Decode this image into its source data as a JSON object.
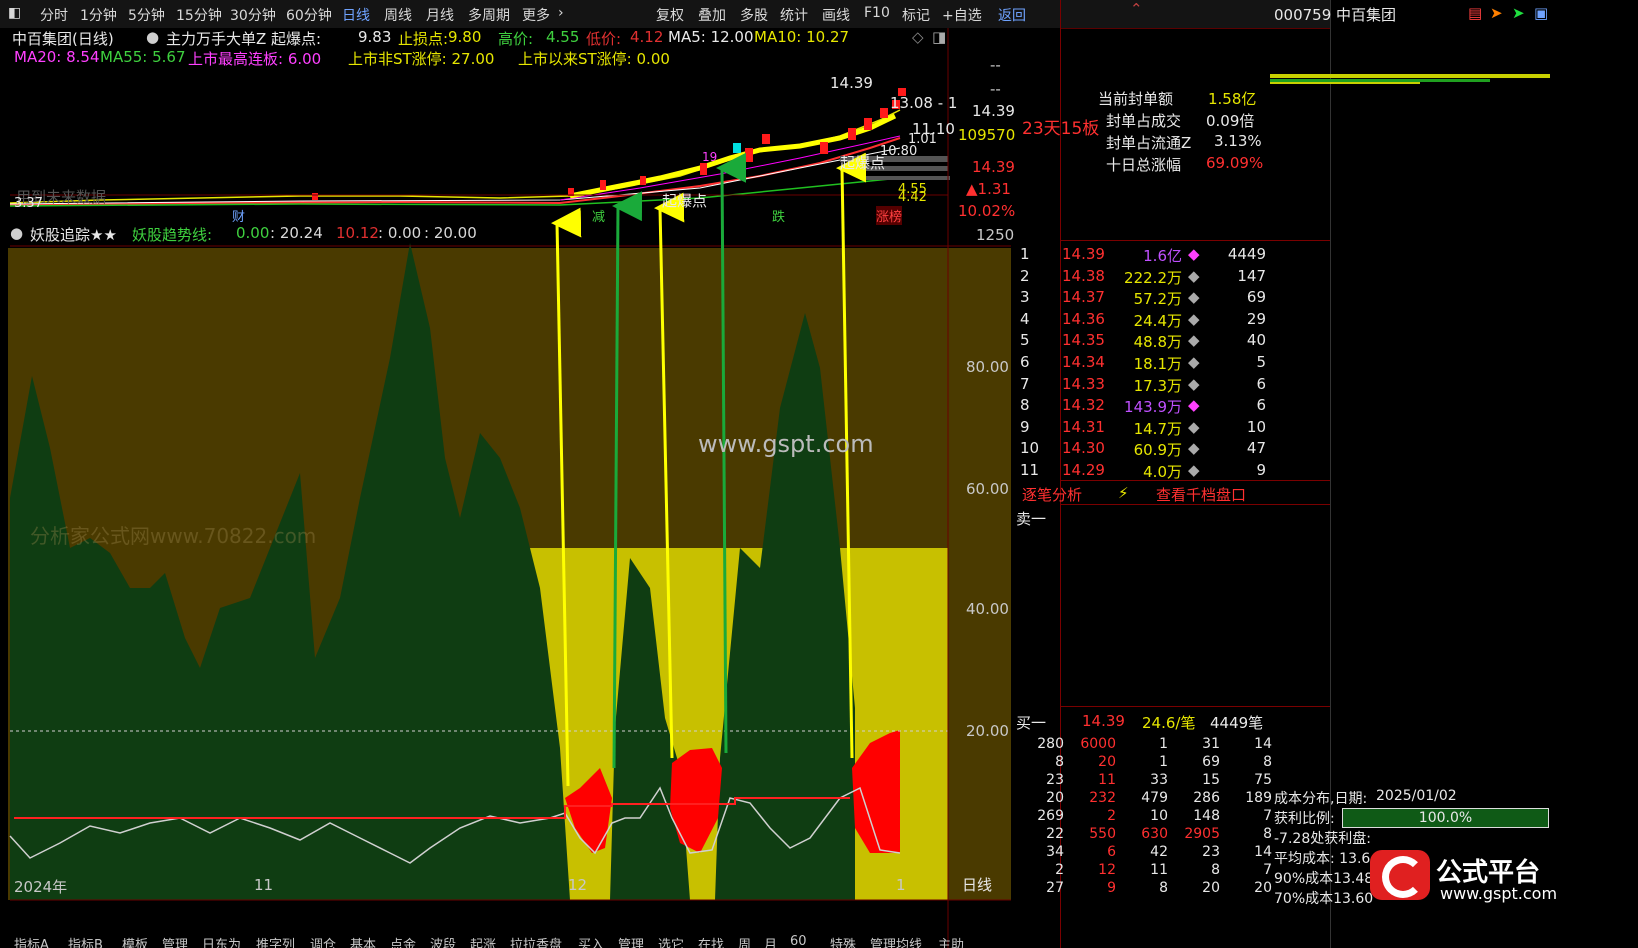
{
  "toolbar": {
    "periods": [
      "分时",
      "1分钟",
      "5分钟",
      "15分钟",
      "30分钟",
      "60分钟",
      "日线",
      "周线",
      "月线",
      "多周期",
      "更多"
    ],
    "active_period": "日线",
    "tools": [
      "复权",
      "叠加",
      "多股",
      "统计",
      "画线",
      "F10",
      "标记",
      "+自选",
      "返回"
    ]
  },
  "stock_header": {
    "title": "中百集团(日线)",
    "indicator": "主力万手大单Z 起爆点:",
    "indicator_value": "9.83",
    "stop_label": "止损点:",
    "stop_value": "9.80",
    "high_label": "高价:",
    "high_value": "4.55",
    "low_label": "低价:",
    "low_value": "4.12",
    "ma5": "MA5: 12.00",
    "ma10": "MA10: 10.27",
    "ma20": "MA20: 8.54",
    "ma55": "MA55: 5.67",
    "line2_a": "上市最高连板: 6.00",
    "line2_b": "上市非ST涨停: 27.00",
    "line2_c": "上市以来ST涨停: 0.00"
  },
  "price_chart": {
    "labels": {
      "high_mark": "14.39",
      "low_mark": "3.37",
      "target1": "13.08 - 1",
      "target2": "11.10",
      "target3": "1.01",
      "target4": "10.80",
      "target5": "4.55",
      "target6": "4.42",
      "qibao": "起爆点",
      "qibao2": "起爆点",
      "future": "用到未来数据",
      "cai": "财",
      "jian": "减",
      "die": "跌",
      "zhangbang": "涨榜",
      "fund_19": "19"
    },
    "y_ticks": [
      "--",
      "--",
      "14.39",
      "109570",
      "14.39",
      "▲1.31",
      "10.02%",
      "1250"
    ]
  },
  "indicator_panel": {
    "title": "妖股追踪★★",
    "trend_label": "妖股趋势线:",
    "values": [
      {
        "text": "0.00",
        "color": "#3fd13f"
      },
      {
        "text": ": 20.24",
        "color": "#d8d8d8"
      },
      {
        "text": "10.12",
        "color": "#e03030"
      },
      {
        "text": ": 0.00",
        "color": "#d8d8d8"
      },
      {
        "text": ": 20.00",
        "color": "#d8d8d8"
      }
    ],
    "y_ticks": [
      "80.00",
      "60.00",
      "40.00",
      "20.00"
    ],
    "watermark": "www.gspt.com",
    "bg_watermark": "分析家公式网www.70822.com"
  },
  "x_axis": {
    "labels": [
      "2024年",
      "11",
      "12",
      "1"
    ],
    "period": "日线"
  },
  "bottom_tabs": [
    "指标A",
    "指标B",
    "模板",
    "管理",
    "日东为",
    "推字列",
    "调仓",
    "基本",
    "点金",
    "波段",
    "起涨",
    "拉拉香盘",
    "买入",
    "管理",
    "选它",
    "在找",
    "周",
    "月",
    "60",
    "特殊",
    "管理均线",
    "主助"
  ],
  "seal_info": {
    "streak": "23天15板",
    "seal_amount_label": "当前封单额",
    "seal_amount": "1.58亿",
    "seal_vs_volume_label": "封单占成交",
    "seal_vs_volume": "0.09倍",
    "seal_vs_float_label": "封单占流通Z",
    "seal_vs_float": "3.13%",
    "ten_day_label": "十日总涨幅",
    "ten_day": "69.09%"
  },
  "order_book": [
    {
      "n": "1",
      "price": "14.39",
      "vol": "1.6亿",
      "cnt": "4449",
      "hl": true
    },
    {
      "n": "2",
      "price": "14.38",
      "vol": "222.2万",
      "cnt": "147",
      "hl": false
    },
    {
      "n": "3",
      "price": "14.37",
      "vol": "57.2万",
      "cnt": "69",
      "hl": false
    },
    {
      "n": "4",
      "price": "14.36",
      "vol": "24.4万",
      "cnt": "29",
      "hl": false
    },
    {
      "n": "5",
      "price": "14.35",
      "vol": "48.8万",
      "cnt": "40",
      "hl": false
    },
    {
      "n": "6",
      "price": "14.34",
      "vol": "18.1万",
      "cnt": "5",
      "hl": false
    },
    {
      "n": "7",
      "price": "14.33",
      "vol": "17.3万",
      "cnt": "6",
      "hl": false
    },
    {
      "n": "8",
      "price": "14.32",
      "vol": "143.9万",
      "cnt": "6",
      "hl": true
    },
    {
      "n": "9",
      "price": "14.31",
      "vol": "14.7万",
      "cnt": "10",
      "hl": false
    },
    {
      "n": "10",
      "price": "14.30",
      "vol": "60.9万",
      "cnt": "47",
      "hl": false
    },
    {
      "n": "11",
      "price": "14.29",
      "vol": "4.0万",
      "cnt": "9",
      "hl": false
    }
  ],
  "tabs": {
    "tick": "逐笔分析",
    "depth": "查看千档盘口"
  },
  "sell_label": "卖一",
  "buy_row": {
    "label": "买一",
    "price": "14.39",
    "vol": "24.6/笔",
    "cnt": "4449笔"
  },
  "trades": [
    [
      "280",
      "6000",
      "1",
      "31",
      "14"
    ],
    [
      "8",
      "20",
      "1",
      "69",
      "8"
    ],
    [
      "23",
      "11",
      "33",
      "15",
      "75"
    ],
    [
      "20",
      "232",
      "479",
      "286",
      "189"
    ],
    [
      "269",
      "2",
      "10",
      "148",
      "7"
    ],
    [
      "22",
      "550",
      "630",
      "2905",
      "8"
    ],
    [
      "34",
      "6",
      "42",
      "23",
      "14"
    ],
    [
      "2",
      "12",
      "11",
      "8",
      "7"
    ],
    [
      "27",
      "9",
      "8",
      "20",
      "20"
    ]
  ],
  "stock_code": "000759 中百集团",
  "cost_dist": {
    "date_label": "成本分布,日期:",
    "date": "2025/01/02",
    "profit_label": "获利比例:",
    "profit": "100.0%",
    "profit_fill": 1.0,
    "line3": "-7.28处获利盘:",
    "avg": "平均成本: 13.6",
    "c90": "90%成本13.48",
    "c70": "70%成本13.60"
  },
  "logo": {
    "brand": "公式平台",
    "url": "www.gspt.com"
  },
  "colors": {
    "yellow": "#e6e600",
    "green": "#1a9a3a",
    "red": "#ff0000",
    "olive": "#4a3a00",
    "blue": "#6fa3ff"
  }
}
